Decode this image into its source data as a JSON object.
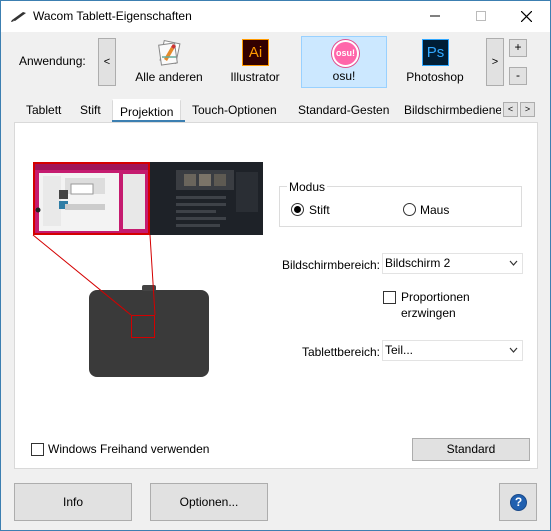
{
  "window": {
    "title": "Wacom Tablett-Eigenschaften"
  },
  "application_bar": {
    "label": "Anwendung:",
    "prev_label": "<",
    "next_label": ">",
    "add_label": "+",
    "remove_label": "-",
    "apps": [
      {
        "label": "Alle anderen",
        "icon": "all-apps-icon",
        "selected": false
      },
      {
        "label": "Illustrator",
        "icon": "illustrator-icon",
        "icon_text": "Ai",
        "selected": false
      },
      {
        "label": "osu!",
        "icon": "osu-icon",
        "icon_text": "osu!",
        "selected": true
      },
      {
        "label": "Photoshop",
        "icon": "photoshop-icon",
        "icon_text": "Ps",
        "selected": false
      }
    ]
  },
  "tabs": [
    {
      "label": "Tablett",
      "active": false
    },
    {
      "label": "Stift",
      "active": false
    },
    {
      "label": "Projektion",
      "active": true
    },
    {
      "label": "Touch-Optionen",
      "active": false
    },
    {
      "label": "Standard-Gesten",
      "active": false
    },
    {
      "label": "Bildschirmbediene",
      "active": false
    }
  ],
  "tab_scroll": {
    "left": "<",
    "right": ">"
  },
  "projection": {
    "mode": {
      "title": "Modus",
      "options": [
        {
          "label": "Stift",
          "checked": true
        },
        {
          "label": "Maus",
          "checked": false
        }
      ]
    },
    "screen_area": {
      "label": "Bildschirmbereich:",
      "value": "Bildschirm 2"
    },
    "force_proportions": {
      "label_line1": "Proportionen",
      "label_line2": "erzwingen",
      "checked": false
    },
    "tablet_area": {
      "label": "Tablettbereich:",
      "value": "Teil..."
    },
    "windows_ink": {
      "label": "Windows Freihand verwenden",
      "checked": false
    },
    "default_button": "Standard"
  },
  "footer": {
    "info_button": "Info",
    "options_button": "Optionen...",
    "help_icon": "?"
  },
  "colors": {
    "accent": "#3c7fb1",
    "selected_tile": "#cce8ff",
    "mapping_red": "#d40000",
    "illustrator_bg": "#330000",
    "illustrator_fg": "#ff9a00",
    "osu_pink": "#ff66aa",
    "photoshop_bg": "#001e36",
    "photoshop_fg": "#31a8ff"
  }
}
